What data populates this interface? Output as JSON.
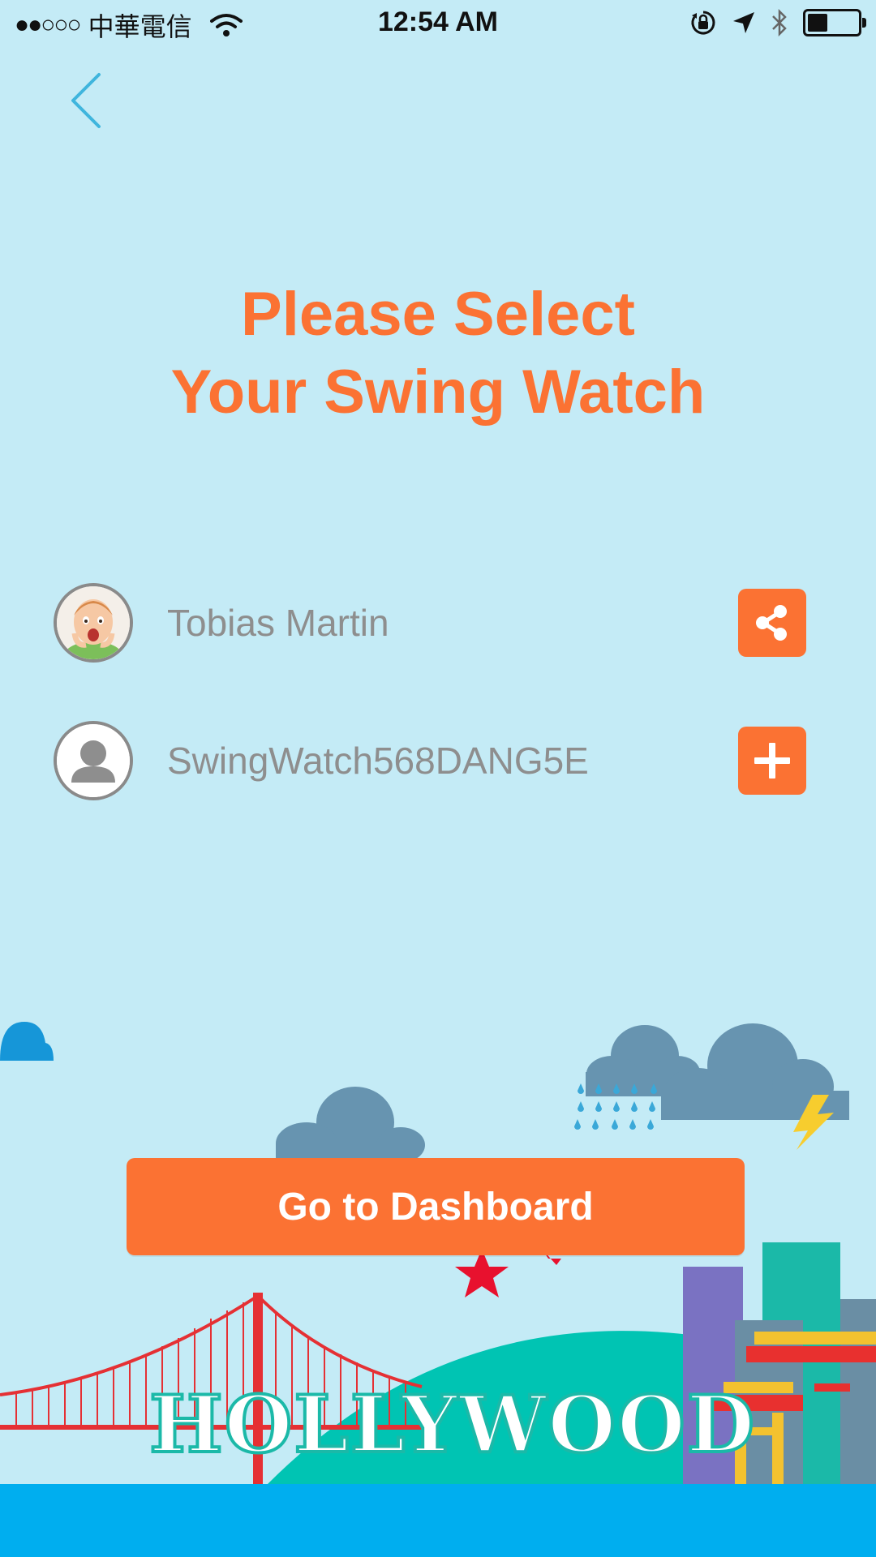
{
  "status_bar": {
    "signal": "●●○○○",
    "carrier": "中華電信",
    "time": "12:54 AM"
  },
  "header": {
    "title_line1": "Please Select",
    "title_line2": "Your Swing Watch"
  },
  "devices": [
    {
      "name": "Tobias Martin",
      "action_icon": "share-icon"
    },
    {
      "name": "SwingWatch568DANG5E",
      "action_icon": "plus-icon"
    }
  ],
  "footer": {
    "dashboard_label": "Go to Dashboard",
    "scene_sign": "HOLLYWOOD"
  },
  "colors": {
    "background": "#c4ebf6",
    "accent": "#fb7233",
    "back_arrow": "#3fb5dd",
    "water": "#00aeef"
  }
}
